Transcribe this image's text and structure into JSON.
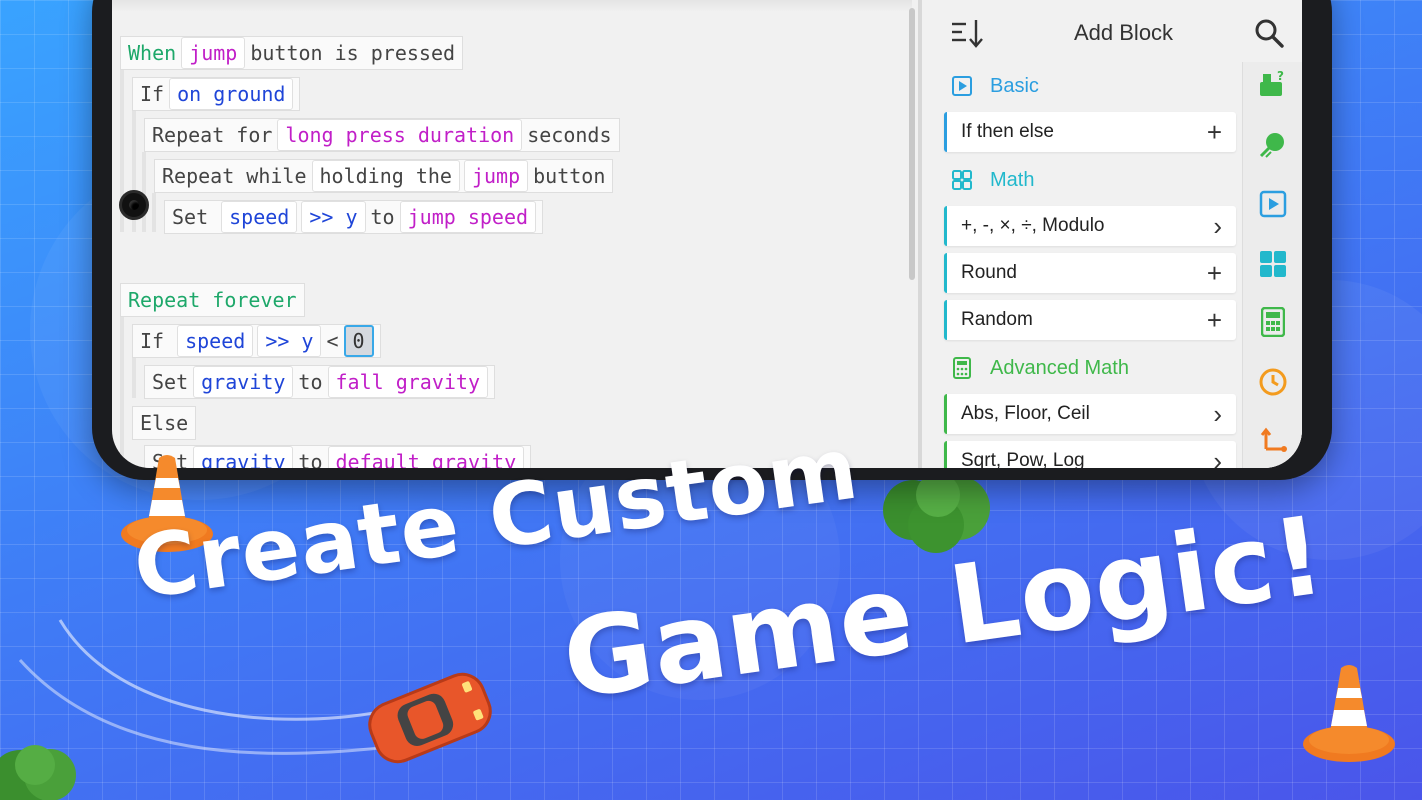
{
  "code": {
    "line1": {
      "when": "When",
      "jump": "jump",
      "rest": "button is pressed"
    },
    "line2": {
      "if": "If",
      "cond": "on ground"
    },
    "line3": {
      "repeat_for": "Repeat for",
      "duration": "long press duration",
      "seconds": "seconds"
    },
    "line4": {
      "repeat_while": "Repeat while",
      "holding": "holding the",
      "jump": "jump",
      "button": "button"
    },
    "line5": {
      "set": "Set",
      "speed": "speed",
      "y": ">> y",
      "to": "to",
      "value": "jump speed"
    },
    "line6": {
      "repeat_forever": "Repeat forever"
    },
    "line7": {
      "if": "If",
      "speed": "speed",
      "y": ">> y",
      "lt": "<",
      "zero": "0"
    },
    "line8": {
      "set": "Set",
      "gravity": "gravity",
      "to": "to",
      "value": "fall gravity"
    },
    "line9": {
      "else": "Else"
    },
    "line10": {
      "set": "Set",
      "gravity": "gravity",
      "to": "to",
      "value": "default gravity"
    }
  },
  "panel": {
    "title": "Add Block",
    "categories": [
      {
        "label": "Basic",
        "color": "#2b9ee0",
        "icon": "play-square-icon"
      },
      {
        "label": "Math",
        "color": "#22b8cc",
        "icon": "math-grid-icon"
      },
      {
        "label": "Advanced Math",
        "color": "#3fb84a",
        "icon": "calculator-icon"
      }
    ],
    "items": [
      {
        "label": "If then else",
        "action": "+",
        "color": "#2b9ee0"
      },
      {
        "label": "+, -, ×, ÷, Modulo",
        "action": "›",
        "color": "#22b8cc"
      },
      {
        "label": "Round",
        "action": "+",
        "color": "#22b8cc"
      },
      {
        "label": "Random",
        "action": "+",
        "color": "#22b8cc"
      },
      {
        "label": "Abs, Floor, Ceil",
        "action": "›",
        "color": "#3fb84a"
      },
      {
        "label": "Sqrt, Pow, Log",
        "action": "›",
        "color": "#3fb84a"
      }
    ],
    "tabs": [
      "sensor-question-icon",
      "physics-icon",
      "play-square-icon",
      "math-grid-icon",
      "calculator-icon",
      "clock-icon",
      "variables-icon"
    ]
  },
  "headline": {
    "line1": "Create Custom",
    "line2": "Game Logic!"
  }
}
